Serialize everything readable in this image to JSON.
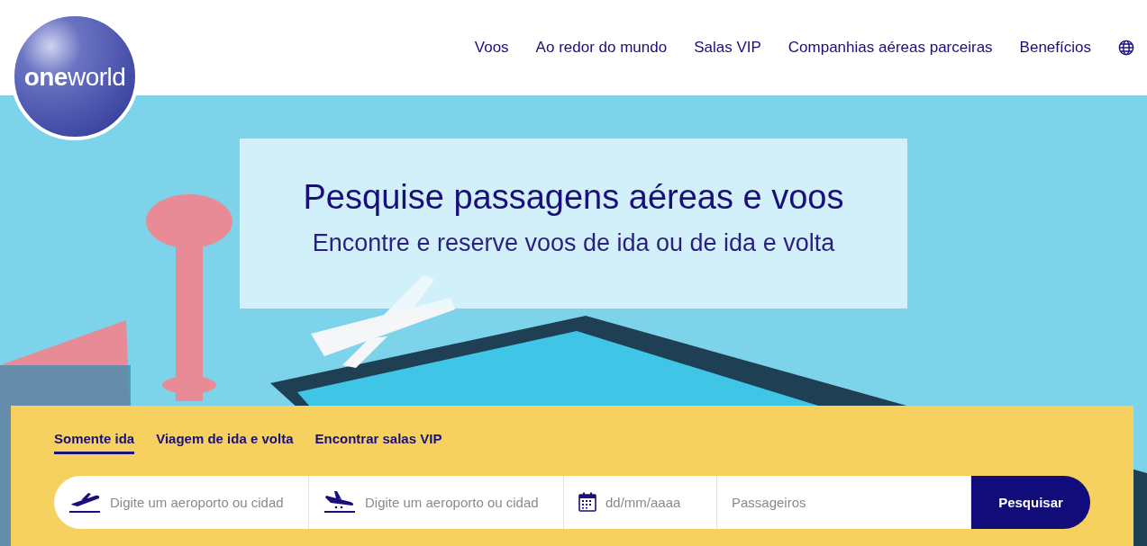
{
  "logo": {
    "text_bold": "one",
    "text_light": "world"
  },
  "nav": {
    "items": [
      "Voos",
      "Ao redor do mundo",
      "Salas VIP",
      "Companhias aéreas parceiras",
      "Benefícios"
    ]
  },
  "hero": {
    "title": "Pesquise passagens aéreas e voos",
    "subtitle": "Encontre e reserve voos de ida ou de ida e volta"
  },
  "search": {
    "tabs": [
      {
        "label": "Somente ida",
        "selected": true
      },
      {
        "label": "Viagem de ida e volta",
        "selected": false
      },
      {
        "label": "Encontrar salas VIP",
        "selected": false
      }
    ],
    "fields": [
      {
        "kind": "departure",
        "placeholder": "Digite um aeroporto ou cidad"
      },
      {
        "kind": "arrival",
        "placeholder": "Digite um aeroporto ou cidad"
      },
      {
        "kind": "date",
        "placeholder": "dd/mm/aaaa"
      },
      {
        "kind": "passengers",
        "placeholder": "Passageiros"
      }
    ],
    "button": "Pesquisar"
  }
}
